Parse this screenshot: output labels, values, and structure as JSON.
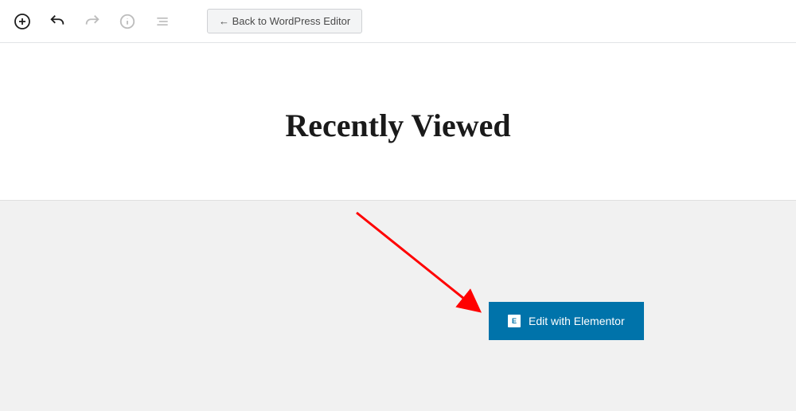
{
  "toolbar": {
    "back_button_label": "← Back to WordPress Editor"
  },
  "header": {
    "page_title": "Recently Viewed"
  },
  "content": {
    "elementor_button_label": "Edit with Elementor",
    "elementor_icon_text": "E"
  }
}
